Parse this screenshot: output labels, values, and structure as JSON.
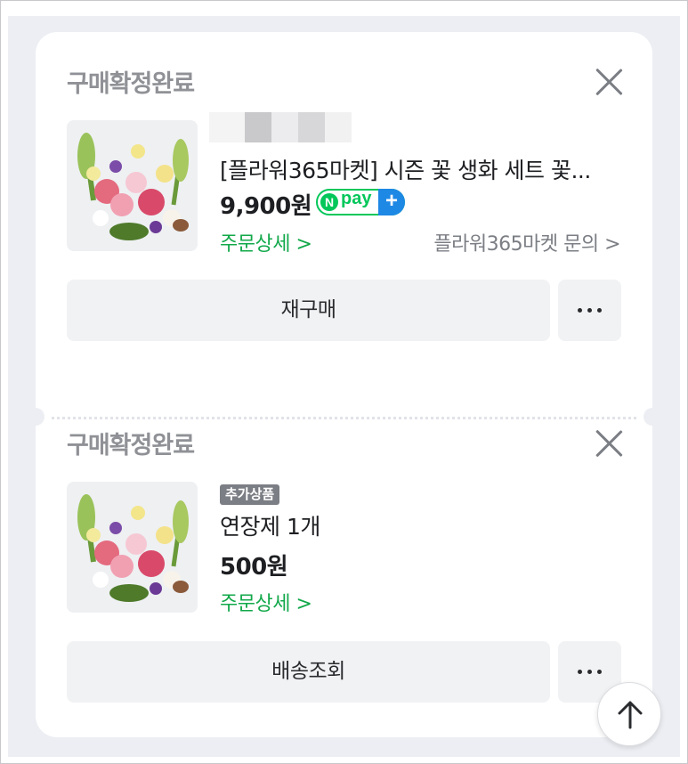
{
  "orders": [
    {
      "status": "구매확정완료",
      "title": "[플라워365마켓] 시즌 꽃 생화 세트 꽃...",
      "price": "9,900원",
      "npay_label": "pay",
      "npay_n": "N",
      "npay_plus": "+",
      "order_detail": "주문상세 >",
      "inquiry": "플라워365마켓 문의 >",
      "primary_button": "재구매"
    },
    {
      "status": "구매확정완료",
      "badge": "추가상품",
      "title": "연장제 1개",
      "price": "500원",
      "order_detail": "주문상세 >",
      "primary_button": "배송조회"
    }
  ],
  "icons": {
    "close": "close-icon",
    "more": "more-dots-icon",
    "scroll_top": "arrow-up-icon",
    "product": "flower-bouquet-thumbnail"
  },
  "colors": {
    "accent_green": "#03c75a",
    "link_green": "#12a84a",
    "npay_blue": "#1e88e5",
    "background": "#eceef3"
  }
}
